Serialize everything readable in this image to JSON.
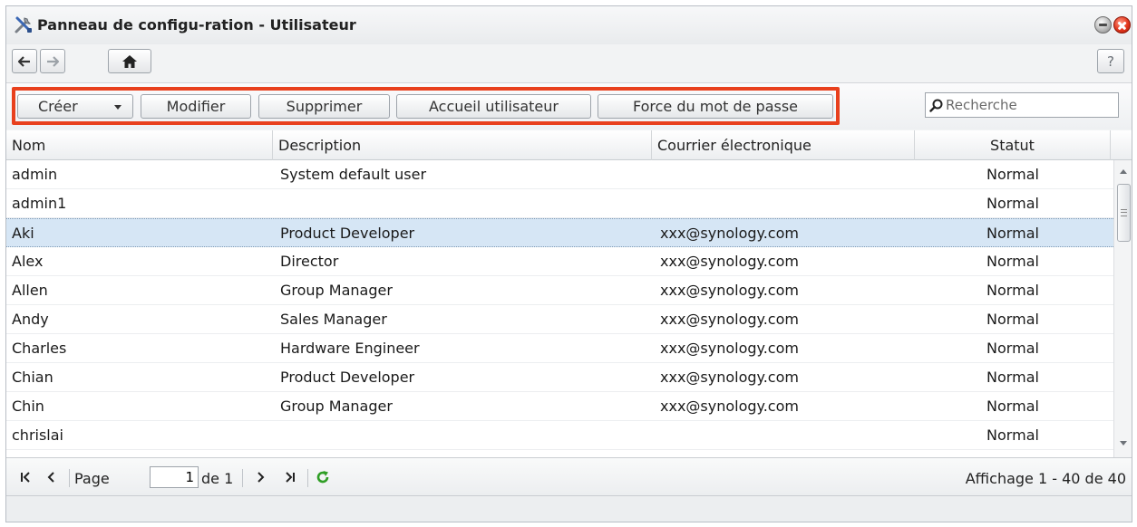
{
  "window": {
    "title": "Panneau de configu-ration - Utilisateur"
  },
  "nav": {
    "help_label": "?"
  },
  "toolbar": {
    "create_label": "Créer",
    "modify_label": "Modifier",
    "delete_label": "Supprimer",
    "home_label": "Accueil utilisateur",
    "password_strength_label": "Force du mot de passe",
    "search_placeholder": "Recherche",
    "highlight_color": "#e8401d"
  },
  "grid": {
    "columns": [
      "Nom",
      "Description",
      "Courrier électronique",
      "Statut"
    ],
    "rows": [
      {
        "name": "admin",
        "description": "System default user",
        "email": "",
        "status": "Normal"
      },
      {
        "name": "admin1",
        "description": "",
        "email": "",
        "status": "Normal"
      },
      {
        "name": "Aki",
        "description": "Product Developer",
        "email": "xxx@synology.com",
        "status": "Normal"
      },
      {
        "name": "Alex",
        "description": "Director",
        "email": "xxx@synology.com",
        "status": "Normal"
      },
      {
        "name": "Allen",
        "description": "Group Manager",
        "email": "xxx@synology.com",
        "status": "Normal"
      },
      {
        "name": "Andy",
        "description": "Sales Manager",
        "email": "xxx@synology.com",
        "status": "Normal"
      },
      {
        "name": "Charles",
        "description": "Hardware Engineer",
        "email": "xxx@synology.com",
        "status": "Normal"
      },
      {
        "name": "Chian",
        "description": "Product Developer",
        "email": "xxx@synology.com",
        "status": "Normal"
      },
      {
        "name": "Chin",
        "description": "Group Manager",
        "email": "xxx@synology.com",
        "status": "Normal"
      },
      {
        "name": "chrislai",
        "description": "",
        "email": "",
        "status": "Normal"
      }
    ],
    "selected_row_color": "#d6e6f5"
  },
  "pager": {
    "page_label": "Page",
    "page_value": "1",
    "of_label": "de 1",
    "display_text": "Affichage 1 - 40 de 40"
  }
}
